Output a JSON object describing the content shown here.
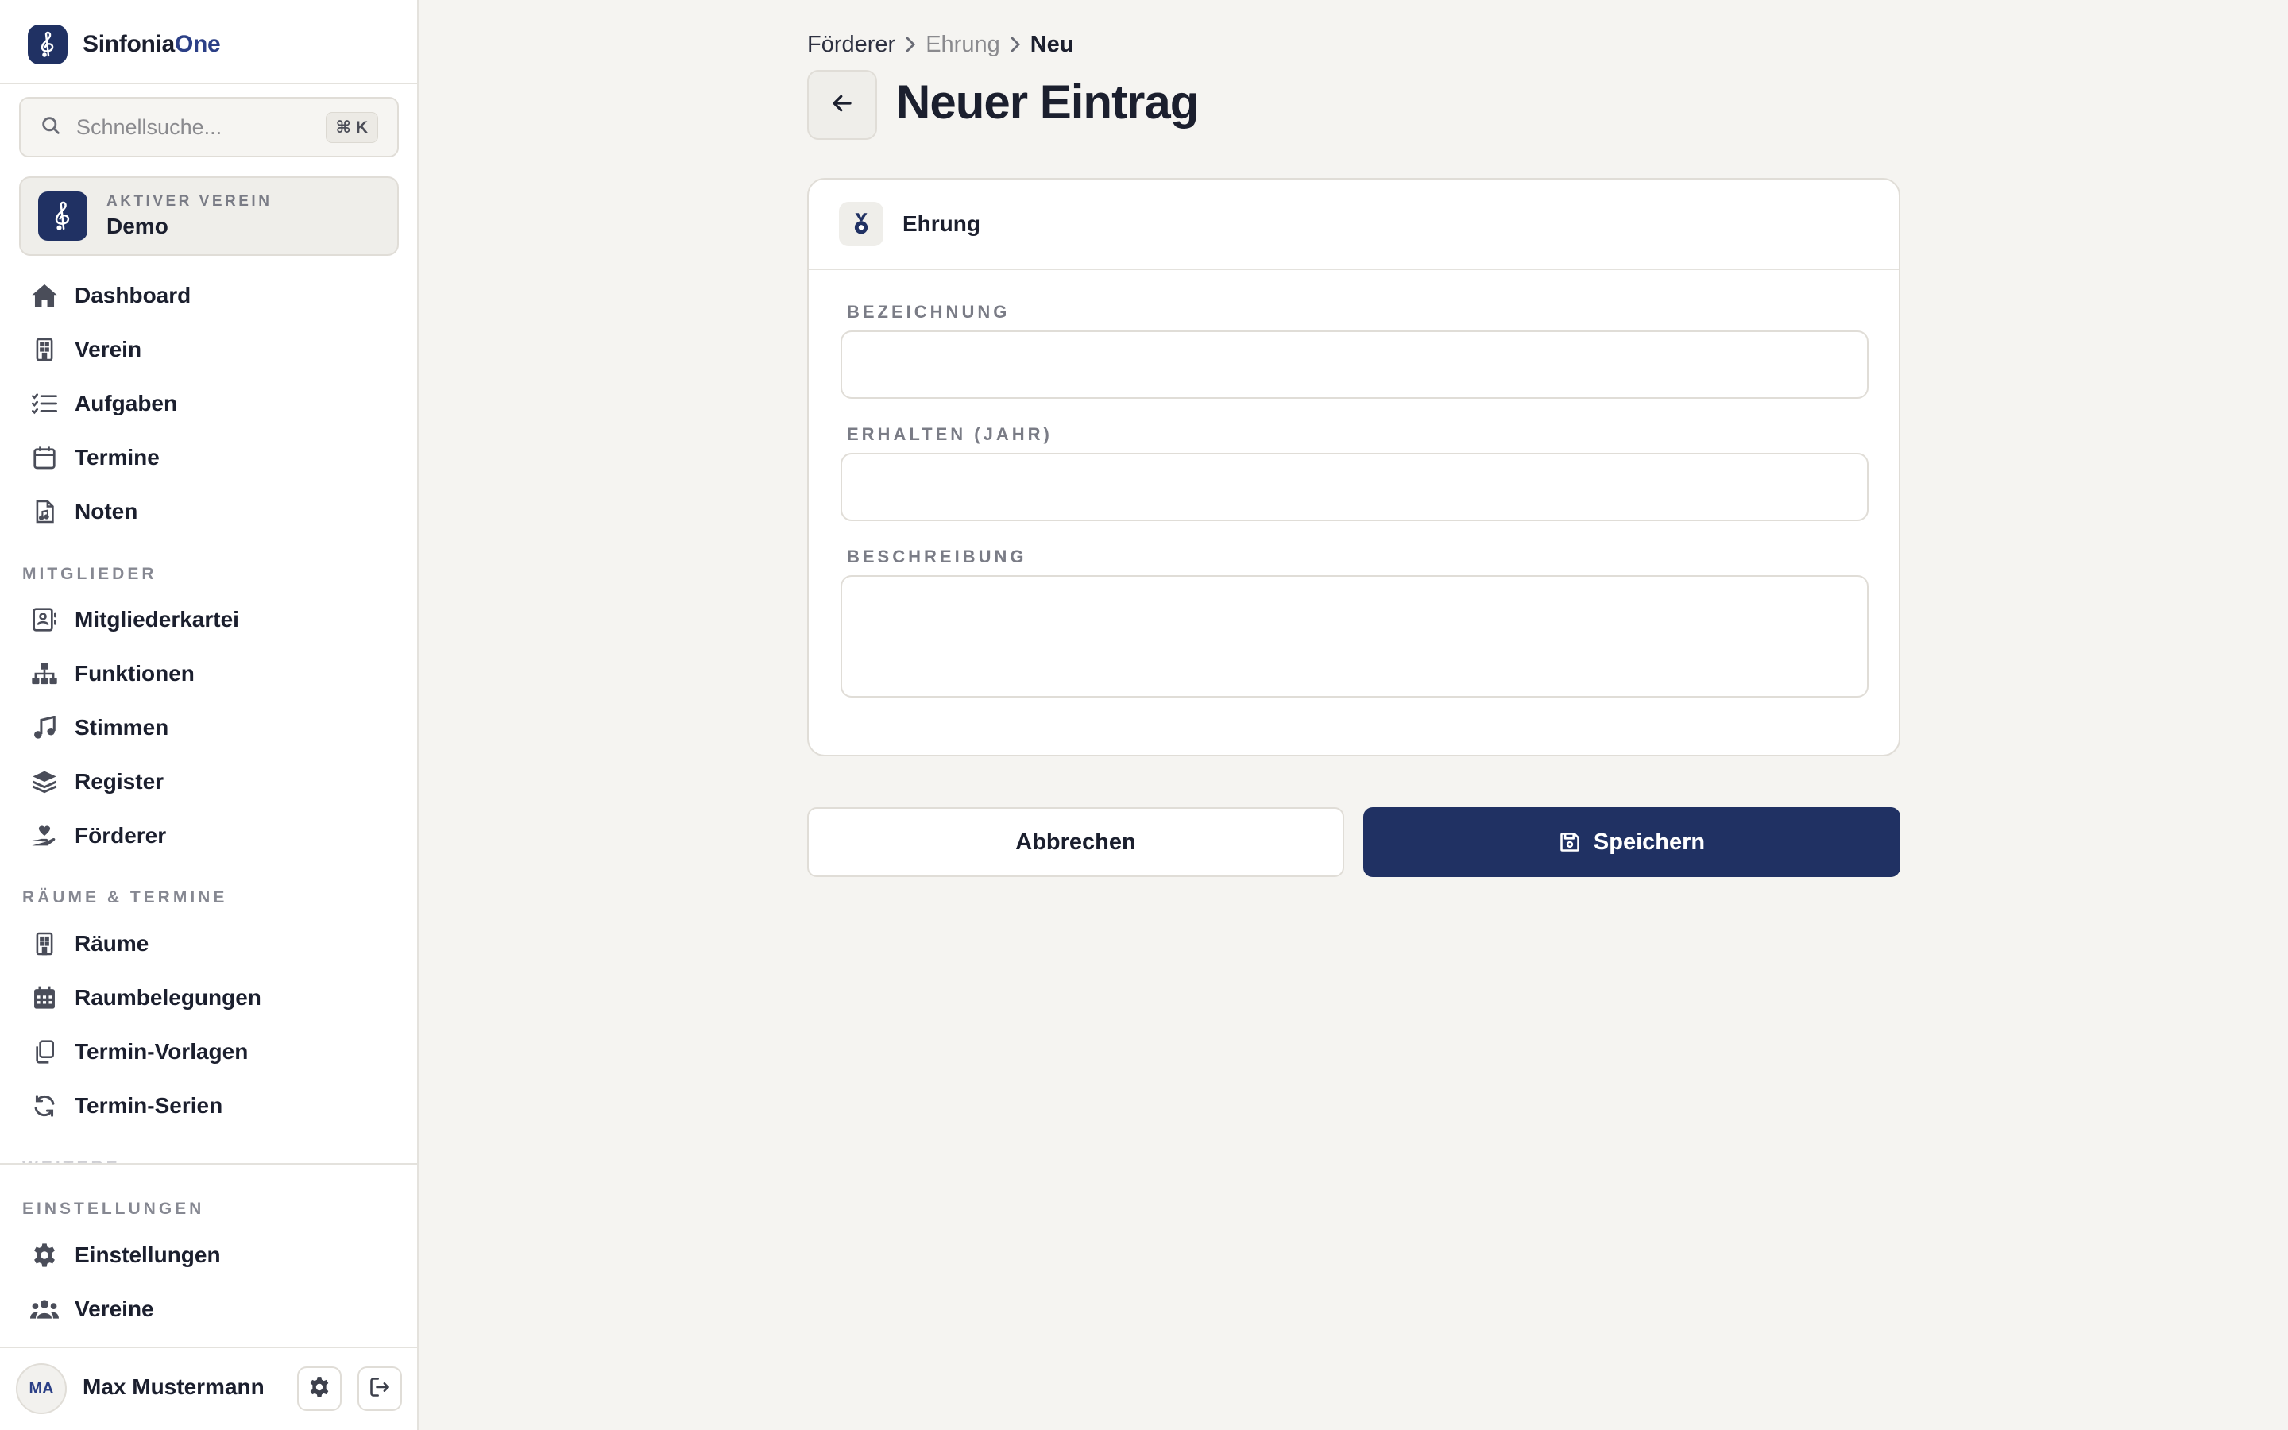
{
  "brand": {
    "name_main": "Sinfonia",
    "name_accent": "One",
    "logo_icon": "treble-clef-icon"
  },
  "search": {
    "placeholder": "Schnellsuche...",
    "shortcut": "⌘ K"
  },
  "active_club": {
    "label": "AKTIVER VEREIN",
    "name": "Demo"
  },
  "nav": {
    "main": [
      {
        "label": "Dashboard",
        "icon": "home-icon"
      },
      {
        "label": "Verein",
        "icon": "building-icon"
      },
      {
        "label": "Aufgaben",
        "icon": "task-list-icon"
      },
      {
        "label": "Termine",
        "icon": "calendar-icon"
      },
      {
        "label": "Noten",
        "icon": "sheet-music-file-icon"
      }
    ],
    "members_section": "MITGLIEDER",
    "members": [
      {
        "label": "Mitgliederkartei",
        "icon": "contact-card-icon"
      },
      {
        "label": "Funktionen",
        "icon": "org-chart-icon"
      },
      {
        "label": "Stimmen",
        "icon": "music-note-icon"
      },
      {
        "label": "Register",
        "icon": "layers-icon"
      },
      {
        "label": "Förderer",
        "icon": "hand-heart-icon"
      }
    ],
    "rooms_section": "RÄUME & TERMINE",
    "rooms": [
      {
        "label": "Räume",
        "icon": "building-icon"
      },
      {
        "label": "Raumbelegungen",
        "icon": "calendar-grid-icon"
      },
      {
        "label": "Termin-Vorlagen",
        "icon": "copy-icon"
      },
      {
        "label": "Termin-Serien",
        "icon": "refresh-icon"
      }
    ],
    "settings_section": "EINSTELLUNGEN",
    "settings": [
      {
        "label": "Einstellungen",
        "icon": "gear-icon"
      },
      {
        "label": "Vereine",
        "icon": "users-icon"
      }
    ]
  },
  "user": {
    "initials": "MA",
    "name": "Max Mustermann"
  },
  "breadcrumb": {
    "items": [
      "Förderer",
      "Ehrung",
      "Neu"
    ]
  },
  "page": {
    "title": "Neuer Eintrag"
  },
  "card": {
    "title": "Ehrung",
    "icon": "medal-icon",
    "fields": [
      {
        "label": "BEZEICHNUNG",
        "value": "",
        "placeholder": ""
      },
      {
        "label": "ERHALTEN (JAHR)",
        "value": "",
        "placeholder": ""
      },
      {
        "label": "BESCHREIBUNG",
        "value": "",
        "placeholder": ""
      }
    ]
  },
  "actions": {
    "cancel": "Abbrechen",
    "save": "Speichern"
  },
  "colors": {
    "primary": "#203163",
    "background": "#f5f4f1",
    "sidebar": "#ffffff"
  }
}
